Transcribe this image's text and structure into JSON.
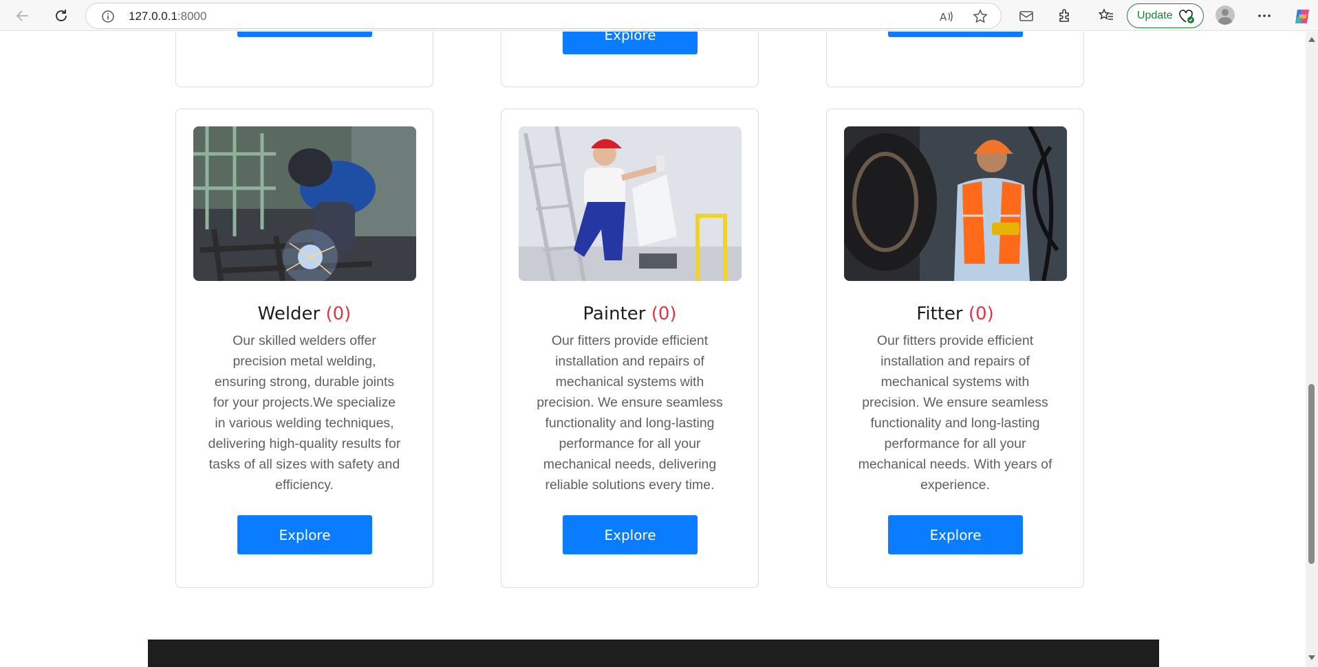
{
  "browser": {
    "url_host": "127.0.0.1",
    "url_port": ":8000",
    "update_label": "Update"
  },
  "top_cards": [
    {
      "explore_label": ""
    },
    {
      "explore_label": "Explore"
    },
    {
      "explore_label": ""
    }
  ],
  "services": [
    {
      "title": "Welder",
      "count": "(0)",
      "description": "Our skilled welders offer precision metal welding, ensuring strong, durable joints for your projects.We specialize in various welding techniques, delivering high-quality results for tasks of all sizes with safety and efficiency.",
      "explore_label": "Explore"
    },
    {
      "title": "Painter",
      "count": "(0)",
      "description": "Our fitters provide efficient installation and repairs of mechanical systems with precision. We ensure seamless functionality and long-lasting performance for all your mechanical needs, delivering reliable solutions every time.",
      "explore_label": "Explore"
    },
    {
      "title": "Fitter",
      "count": "(0)",
      "description": "Our fitters provide efficient installation and repairs of mechanical systems with precision. We ensure seamless functionality and long-lasting performance for all your mechanical needs. With years of experience.",
      "explore_label": "Explore"
    }
  ],
  "colors": {
    "button": "#0a7cff",
    "count": "#dc3545",
    "footer": "#1e1e1e"
  }
}
